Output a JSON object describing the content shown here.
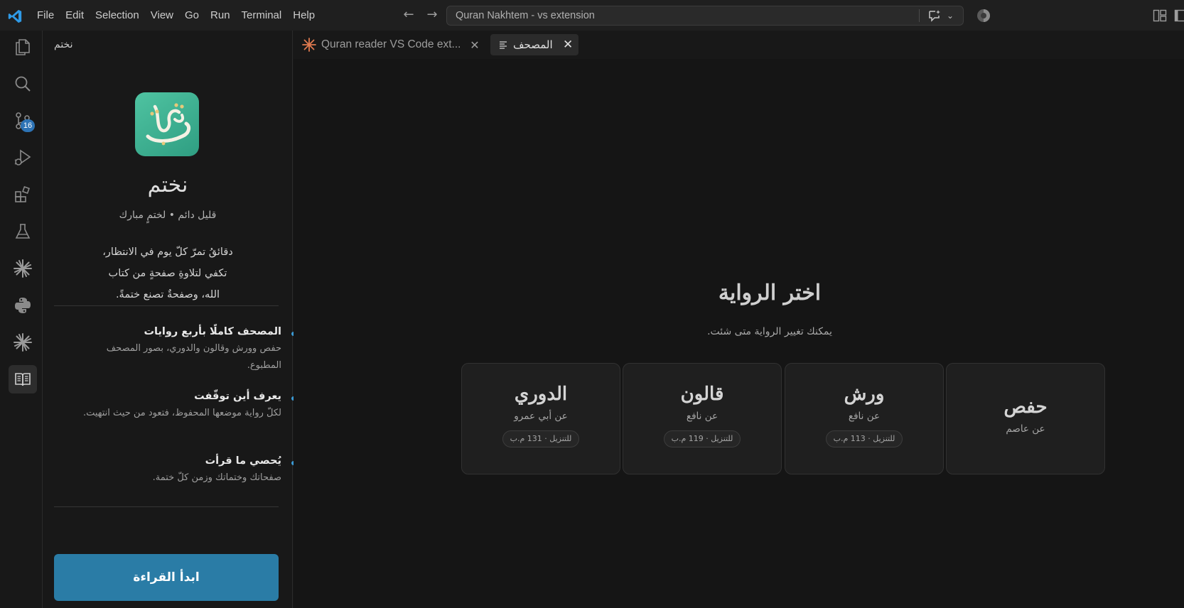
{
  "titlebar": {
    "menu": [
      "File",
      "Edit",
      "Selection",
      "View",
      "Go",
      "Run",
      "Terminal",
      "Help"
    ],
    "search_text": "Quran Nakhtem - vs extension",
    "icons": [
      "vscode-logo-icon",
      "arrow-left-icon",
      "arrow-right-icon",
      "chat-sparkle-icon",
      "chevron-down-icon",
      "copilot-icon",
      "layout-icon"
    ]
  },
  "activitybar": {
    "items": [
      {
        "name": "explorer",
        "icon": "files-icon"
      },
      {
        "name": "search",
        "icon": "search-icon"
      },
      {
        "name": "source-control",
        "icon": "source-control-icon",
        "badge": "16"
      },
      {
        "name": "run-debug",
        "icon": "run-debug-icon"
      },
      {
        "name": "extensions",
        "icon": "extensions-icon"
      },
      {
        "name": "testing",
        "icon": "beaker-icon"
      },
      {
        "name": "claude",
        "icon": "sparkle-burst-icon"
      },
      {
        "name": "python",
        "icon": "python-icon"
      },
      {
        "name": "claude-2",
        "icon": "sparkle-burst-icon"
      },
      {
        "name": "quran-reader",
        "icon": "book-icon",
        "active": true
      }
    ]
  },
  "sidebar": {
    "title": "نختم",
    "brand_name": "نختم",
    "tagline": "قليل دائم • لختمٍ مبارك",
    "intro": [
      "دقائقُ تمرّ كلّ يوم في الانتظار،",
      "تكفي لتلاوةِ صفحةٍ من كتاب",
      "الله، وصفحةٌ تصنع ختمةً."
    ],
    "features": [
      {
        "title": "المصحف كاملًا بأربع روايات",
        "desc": "حفص وورش وقالون والدوري، بصور المصحف المطبوع."
      },
      {
        "title": "يعرف أين توقّفت",
        "desc": "لكلّ رواية موضعها المحفوظ، فتعود من حيث انتهيت."
      },
      {
        "title": "يُحصي ما قرأت",
        "desc": "صفحاتك وختماتك وزمن كلّ ختمة."
      }
    ],
    "start_button": "ابدأ القراءة"
  },
  "editor": {
    "tabs": [
      {
        "label": "Quran reader VS Code ext...",
        "icon": "sparkle-burst-icon",
        "active": false
      },
      {
        "label": "المصحف",
        "icon": "preview-lines-icon",
        "active": true
      }
    ],
    "picker": {
      "title": "اختر الرواية",
      "subtitle": "يمكنك تغيير الرواية متى شئت.",
      "riwayat": [
        {
          "name": "الدوري",
          "source": "عن أبي عمرو",
          "chip": "للتنزيل · 131 م.ب"
        },
        {
          "name": "قالون",
          "source": "عن نافع",
          "chip": "للتنزيل · 119 م.ب"
        },
        {
          "name": "ورش",
          "source": "عن نافع",
          "chip": "للتنزيل · 113 م.ب"
        },
        {
          "name": "حفص",
          "source": "عن عاصم",
          "chip": ""
        }
      ]
    }
  },
  "colors": {
    "accent": "#2a7ca6",
    "badge": "#2d73b5",
    "logo_tile": "#3fb592",
    "background": "#181818"
  }
}
